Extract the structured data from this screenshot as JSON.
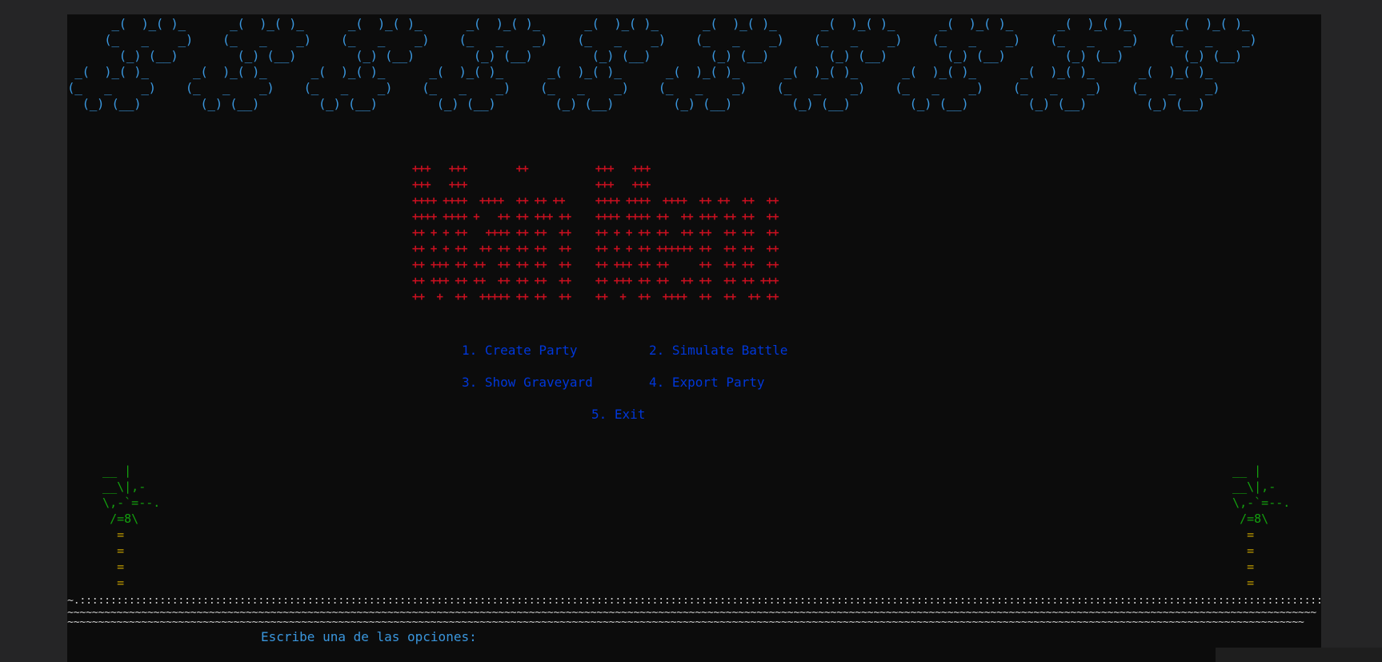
{
  "colors": {
    "terminal_bg": "#0c0c0c",
    "window_bg": "#252526",
    "clouds": "#3a96dd",
    "title_art": "#c50f1f",
    "menu": "#0037da",
    "palm_leaves": "#13a10e",
    "palm_trunk": "#c19c00",
    "ground": "#cccccc",
    "prompt": "#3a96dd"
  },
  "clouds_art": "      _(  )_( )_      _(  )_( )_      _(  )_( )_      _(  )_( )_      _(  )_( )_      _(  )_( )_      _(  )_( )_      _(  )_( )_      _(  )_( )_      _(  )_( )_\n     (_   _    _)    (_   _    _)    (_   _    _)    (_   _    _)    (_   _    _)    (_   _    _)    (_   _    _)    (_   _    _)    (_   _    _)    (_   _    _)\n       (_) (__)        (_) (__)        (_) (__)        (_) (__)        (_) (__)        (_) (__)        (_) (__)        (_) (__)        (_) (__)        (_) (__)\n _(  )_( )_      _(  )_( )_      _(  )_( )_      _(  )_( )_      _(  )_( )_      _(  )_( )_      _(  )_( )_      _(  )_( )_      _(  )_( )_      _(  )_( )_\n(_   _    _)    (_   _    _)    (_   _    _)    (_   _    _)    (_   _    _)    (_   _    _)    (_   _    _)    (_   _    _)    (_   _    _)    (_   _    _)\n  (_) (__)        (_) (__)        (_) (__)        (_) (__)        (_) (__)        (_) (__)        (_) (__)        (_) (__)        (_) (__)        (_) (__)",
  "title_art": "+++   +++        ++           +++   +++\n+++   +++                     +++   +++\n++++ ++++  ++++  ++ ++ ++     ++++ ++++  ++++  ++ ++  ++  ++\n++++ ++++ +   ++ ++ +++ ++    ++++ ++++ ++  ++ +++ ++ ++  ++\n++ + + ++   ++++ ++ ++  ++    ++ + + ++ ++  ++ ++  ++ ++  ++\n++ + + ++  ++ ++ ++ ++  ++    ++ + + ++ ++++++ ++  ++ ++  ++\n++ +++ ++ ++  ++ ++ ++  ++    ++ +++ ++ ++     ++  ++ ++  ++\n++ +++ ++ ++  ++ ++ ++  ++    ++ +++ ++ ++  ++ ++  ++ ++ +++\n++  +  ++  +++++ ++ ++  ++    ++  +  ++  ++++  ++  ++  ++ ++",
  "menu": {
    "create_party": "1. Create Party",
    "simulate_battle": "2. Simulate Battle",
    "show_graveyard": "3. Show Graveyard",
    "export_party": "4. Export Party",
    "exit": "5. Exit"
  },
  "palm_left": {
    "leaves": "  __ |\n  __\\|,-\n  \\,-`=--.\n   /=8\\",
    "trunk": "    =\n    =\n    =\n    ="
  },
  "palm_right": {
    "leaves": "  __ |\n  __\\|,-\n  \\,-`=--.\n   /=8\\",
    "trunk": "    =\n    =\n    =\n    ="
  },
  "ground_line": "~.:::::::::::::::::::::::::::::::::::::::::::::::::::::::::::::::::::::::::::::::::::::::::::::::::::::::::::::::::::::::::::::::::::::::::::::::::::::::::::::::::::::::::::::::::::::::::::::::::::::::::::::..~~",
  "waves_line": "~~~~~~~~~~~~~~~~~~~~~~~~~~~~~~~~~~~~~~~~~~~~~~~~~~~~~~~~~~~~~~~~~~~~~~~~~~~~~~~~~~~~~~~~~~~~~~~~~~~~~~~~~~~~~~~~~~~~~~~~~~~~~~~~~~~~~~~~~~~~~~~~~~~~~~~~~~~~~~~~~~~~~~~~~~~~~~~~~~~~~~~~~~~~~~~~~~~~~~~~~~~\n~~~~~~~~~~~~~~~~~~~~~~~~~~~~~~~~~~~~~~~~~~~~~~~~~~~~~~~~~~~~~~~~~~~~~~~~~~~~~~~~~~~~~~~~~~~~~~~~~~~~~~~~~~~~~~~~~~~~~~~~~~~~~~~~~~~~~~~~~~~~~~~~~~~~~~~~~~~~~~~~~~~~~~~~~~~~~~~~~~~~~~~~~~~~~~~~~~~~~~~~~",
  "prompt": "Escribe una de las opciones:"
}
